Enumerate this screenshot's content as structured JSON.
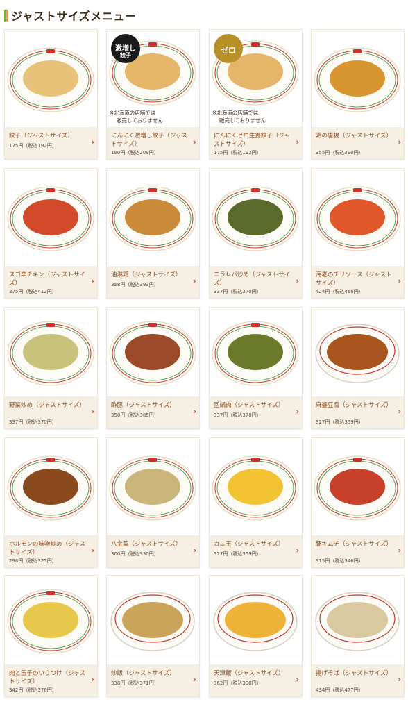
{
  "header": {
    "title": "ジャストサイズメニュー"
  },
  "colors": {
    "accent_green": "#7ab51d",
    "accent_orange": "#f0a21e",
    "card_info_bg": "#f6efe3",
    "name_text": "#8a4a1e",
    "chevron": "#c0392b"
  },
  "menu": [
    {
      "name": "餃子（ジャストサイズ）",
      "price": "175円（税込192円）",
      "icon": "gyoza-plate-image",
      "food_color": "#e9c27a",
      "bowl": false
    },
    {
      "name": "にんにく激増し餃子（ジャストサイズ）",
      "price": "190円（税込209円）",
      "icon": "garlic-gyoza-plate-image",
      "food_color": "#e5b56a",
      "bowl": false,
      "badge": {
        "text": "激増し",
        "sub": "餃子",
        "color": "#1a1a1a"
      },
      "note": [
        "※北海道の店舗では",
        "販売しておりません"
      ]
    },
    {
      "name": "にんにくゼロ生姜餃子（ジャストサイズ）",
      "price": "175円（税込192円）",
      "icon": "ginger-gyoza-plate-image",
      "food_color": "#e5b56a",
      "bowl": false,
      "badge": {
        "text": "ゼロ",
        "sub": "",
        "color": "#b8902a"
      },
      "note": [
        "※北海道の店舗では",
        "販売しておりません"
      ]
    },
    {
      "name": "鶏の唐揚（ジャストサイズ）",
      "price": "355円（税込390円）",
      "icon": "karaage-plate-image",
      "food_color": "#d9952f",
      "bowl": false
    },
    {
      "name": "スゴ辛チキン（ジャストサイズ）",
      "price": "375円（税込412円）",
      "icon": "spicy-chicken-plate-image",
      "food_color": "#d24a2a",
      "bowl": false
    },
    {
      "name": "油淋鶏（ジャストサイズ）",
      "price": "358円（税込393円）",
      "icon": "yurinchi-plate-image",
      "food_color": "#c98a3a",
      "bowl": false
    },
    {
      "name": "ニラレバ炒め（ジャストサイズ）",
      "price": "337円（税込370円）",
      "icon": "nira-reba-plate-image",
      "food_color": "#5a6a2a",
      "bowl": false
    },
    {
      "name": "海老のチリソース（ジャストサイズ）",
      "price": "424円（税込466円）",
      "icon": "ebi-chili-plate-image",
      "food_color": "#e0572c",
      "bowl": false
    },
    {
      "name": "野菜炒め（ジャストサイズ）",
      "price": "337円（税込370円）",
      "icon": "yasai-itame-plate-image",
      "food_color": "#c9c27a",
      "bowl": false
    },
    {
      "name": "酢豚（ジャストサイズ）",
      "price": "350円（税込385円）",
      "icon": "subuta-plate-image",
      "food_color": "#9a4a28",
      "bowl": false
    },
    {
      "name": "回鍋肉（ジャストサイズ）",
      "price": "337円（税込370円）",
      "icon": "hoikoro-plate-image",
      "food_color": "#6a7a2a",
      "bowl": false
    },
    {
      "name": "麻婆豆腐（ジャストサイズ）",
      "price": "327円（税込359円）",
      "icon": "mabo-tofu-bowl-image",
      "food_color": "#a8561e",
      "bowl": true
    },
    {
      "name": "ホルモンの味噌炒め（ジャストサイズ）",
      "price": "296円（税込325円）",
      "icon": "horumon-plate-image",
      "food_color": "#8a4a1e",
      "bowl": false
    },
    {
      "name": "八宝菜（ジャストサイズ）",
      "price": "300円（税込330円）",
      "icon": "happosai-plate-image",
      "food_color": "#c9b47a",
      "bowl": false
    },
    {
      "name": "カニ玉（ジャストサイズ）",
      "price": "327円（税込359円）",
      "icon": "kanitama-plate-image",
      "food_color": "#f1c232",
      "bowl": false
    },
    {
      "name": "豚キムチ（ジャストサイズ）",
      "price": "315円（税込346円）",
      "icon": "buta-kimchi-plate-image",
      "food_color": "#c8402a",
      "bowl": false
    },
    {
      "name": "肉と玉子のいりつけ（ジャストサイズ）",
      "price": "342円（税込376円）",
      "icon": "niku-tamago-plate-image",
      "food_color": "#e8c84a",
      "bowl": false
    },
    {
      "name": "炒飯（ジャストサイズ）",
      "price": "338円（税込371円）",
      "icon": "chahan-bowl-image",
      "food_color": "#c9a45a",
      "bowl": true
    },
    {
      "name": "天津飯（ジャストサイズ）",
      "price": "362円（税込398円）",
      "icon": "tenshinhan-bowl-image",
      "food_color": "#f0b33a",
      "bowl": true
    },
    {
      "name": "揚げそば（ジャストサイズ）",
      "price": "434円（税込477円）",
      "icon": "age-soba-bowl-image",
      "food_color": "#d9c9a0",
      "bowl": true
    }
  ]
}
